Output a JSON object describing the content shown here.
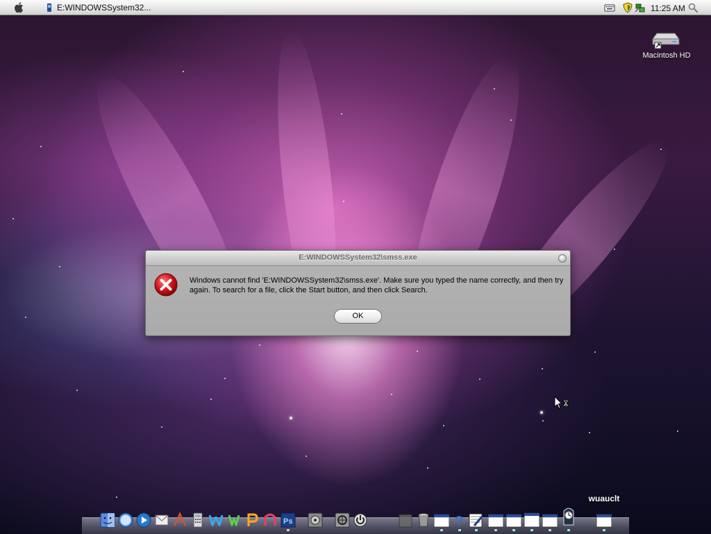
{
  "menubar": {
    "active_task_title": "E:WINDOWSSystem32...",
    "clock": "11:25 AM",
    "tray_icons": [
      "keyboard-icon",
      "security-shield-icon",
      "network-icon",
      "spotlight-search-icon"
    ]
  },
  "desktop": {
    "icons": [
      {
        "label": "Macintosh HD",
        "icon": "hard-drive-icon"
      }
    ]
  },
  "dialog": {
    "title": "E:WINDOWSSystem32\\smss.exe",
    "message": "Windows cannot find 'E:WINDOWSSystem32\\smss.exe'. Make sure you typed the name correctly, and then try again. To search for a file, click the Start button, and then click Search.",
    "icon": "error-icon",
    "ok_label": "OK"
  },
  "dock": {
    "hover_label": "wuauclt",
    "items": [
      "finder-icon",
      "safari-icon",
      "media-player-icon",
      "mail-icon",
      "text-editor-icon",
      "calculator-icon",
      "app-w-icon",
      "app-i-icon",
      "app-p-icon",
      "app-n-icon",
      "photoshop-icon",
      "system-preferences-icon",
      "utility-icon",
      "power-icon",
      "bin-icon",
      "trash-icon",
      "window-icon",
      "help-icon",
      "notepad-icon",
      "window-icon",
      "window-icon",
      "window-icon",
      "window-icon",
      "clock-icon",
      "window-icon"
    ]
  },
  "colors": {
    "menubar": "#e6e6e6",
    "dialog_body": "#aaaaaa",
    "error_red": "#d0141b",
    "dock_label": "#ffffff"
  }
}
